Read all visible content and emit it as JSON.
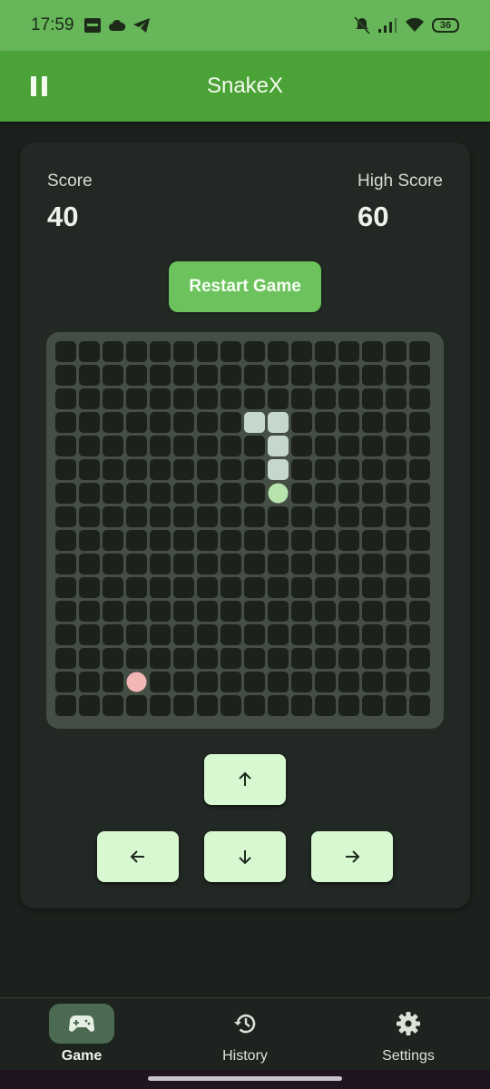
{
  "status_bar": {
    "time": "17:59",
    "battery": "36",
    "notification_icons": [
      "app-badge-icon",
      "cloud-icon",
      "telegram-icon"
    ],
    "system_icons": [
      "mute-bell-icon",
      "signal-icon",
      "wifi-icon",
      "battery-icon"
    ]
  },
  "app_bar": {
    "title": "SnakeX",
    "pause_icon": "pause-icon"
  },
  "scores": {
    "score_label": "Score",
    "score_value": "40",
    "high_score_label": "High Score",
    "high_score_value": "60"
  },
  "restart_button": "Restart Game",
  "board": {
    "columns": 16,
    "rows": 16,
    "snake_body": [
      [
        8,
        3
      ],
      [
        9,
        3
      ],
      [
        9,
        4
      ],
      [
        9,
        5
      ]
    ],
    "snake_head": [
      9,
      6
    ],
    "food": [
      3,
      14
    ],
    "colors": {
      "board_bg": "#454e44",
      "cell": "#1c211b",
      "snake_body": "#c6d8cb",
      "snake_head": "#b7e4ad",
      "food": "#f2b6b4"
    }
  },
  "controls": {
    "up": "arrow-up-icon",
    "left": "arrow-left-icon",
    "down": "arrow-down-icon",
    "right": "arrow-right-icon"
  },
  "bottom_nav": {
    "items": [
      {
        "label": "Game",
        "icon": "gamepad-icon",
        "active": true
      },
      {
        "label": "History",
        "icon": "history-icon",
        "active": false
      },
      {
        "label": "Settings",
        "icon": "settings-icon",
        "active": false
      }
    ]
  },
  "theme": {
    "primary": "#4ba236",
    "status_bar": "#67b75a",
    "accent_button": "#6cc25d",
    "dpad": "#d8f8d2"
  }
}
